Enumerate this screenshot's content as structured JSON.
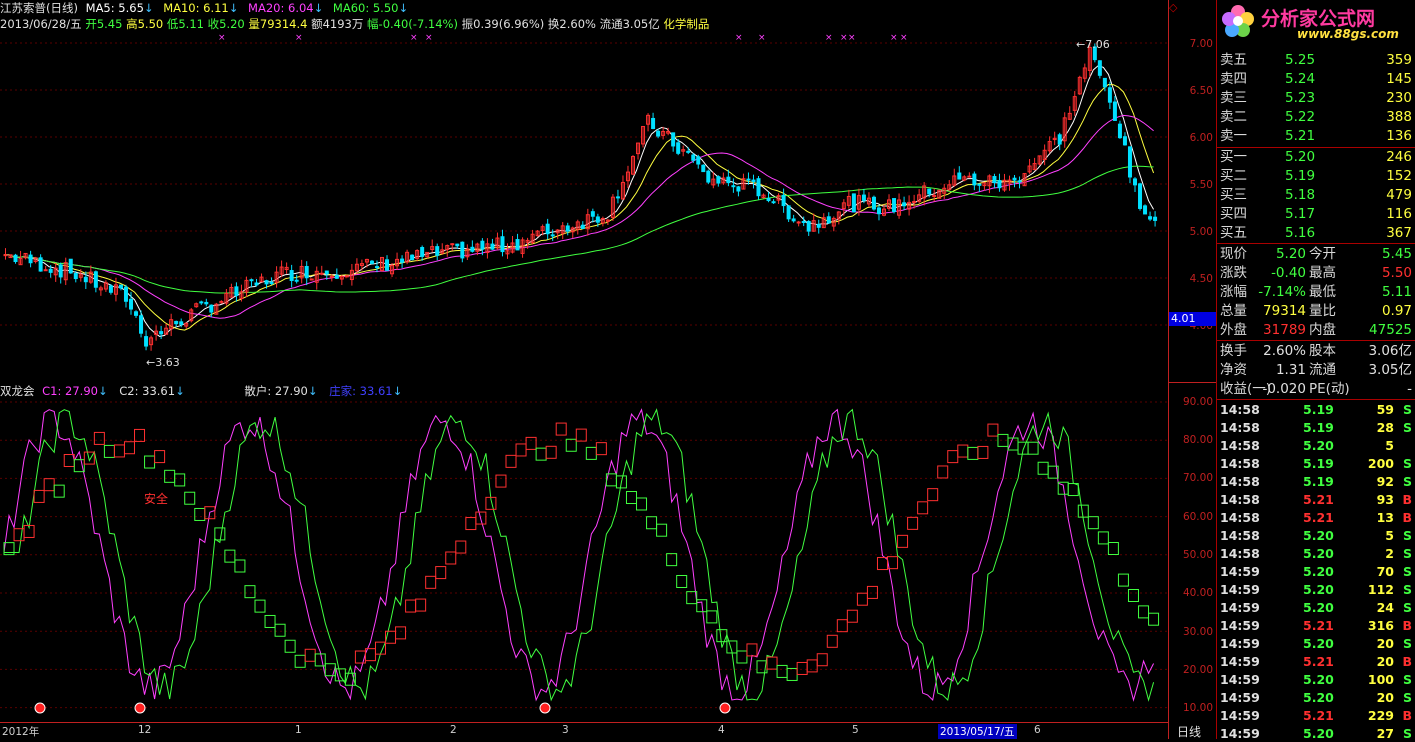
{
  "header": {
    "stock_name": "江苏索普(日线)",
    "ma5_label": "MA5: 5.65",
    "ma10_label": "MA10: 6.11",
    "ma20_label": "MA20: 6.04",
    "ma60_label": "MA60: 5.50",
    "date": "2013/06/28/五",
    "open": "开5.45",
    "high": "高5.50",
    "low": "低5.11",
    "close": "收5.20",
    "volume": "量79314.4",
    "amount": "额4193万",
    "change": "幅-0.40(-7.14%)",
    "amplitude": "振0.39(6.96%)",
    "turnover": "换2.60%",
    "float_cap": "流通3.05亿",
    "sector": "化学制品",
    "down_arrow": "↓"
  },
  "price_chart": {
    "high_label": "7.06",
    "low_label": "3.63",
    "cursor_price": "4.01",
    "axis_ticks": [
      "7.00",
      "6.50",
      "6.00",
      "5.50",
      "5.00",
      "4.50",
      "4.00"
    ],
    "colors": {
      "up": "#ff3030",
      "down": "#00e0ff",
      "ma5": "#ffffff",
      "ma10": "#ffff40",
      "ma20": "#ff40ff",
      "ma60": "#40ff40"
    }
  },
  "indicator": {
    "name": "双龙会",
    "c1": "C1: 27.90",
    "c2": "C2: 33.61",
    "sanhu": "散户: 27.90",
    "zhuangjia": "庄家: 33.61",
    "safe_label": "安全",
    "axis_ticks": [
      "90.00",
      "80.00",
      "70.00",
      "60.00",
      "50.00",
      "40.00",
      "30.00",
      "20.00",
      "10.00"
    ]
  },
  "xaxis": {
    "labels": [
      "2012年",
      "12",
      "1",
      "2",
      "3",
      "4",
      "5",
      "6"
    ],
    "cursor_date": "2013/05/17/五",
    "period_button": "日线"
  },
  "logo": {
    "title": "分析家公式网",
    "url": "www.88gs.com"
  },
  "orderbook": {
    "asks": [
      {
        "label": "卖五",
        "price": "5.25",
        "vol": "359"
      },
      {
        "label": "卖四",
        "price": "5.24",
        "vol": "145"
      },
      {
        "label": "卖三",
        "price": "5.23",
        "vol": "230"
      },
      {
        "label": "卖二",
        "price": "5.22",
        "vol": "388"
      },
      {
        "label": "卖一",
        "price": "5.21",
        "vol": "136"
      }
    ],
    "bids": [
      {
        "label": "买一",
        "price": "5.20",
        "vol": "246"
      },
      {
        "label": "买二",
        "price": "5.19",
        "vol": "152"
      },
      {
        "label": "买三",
        "price": "5.18",
        "vol": "479"
      },
      {
        "label": "买四",
        "price": "5.17",
        "vol": "116"
      },
      {
        "label": "买五",
        "price": "5.16",
        "vol": "367"
      }
    ]
  },
  "quote": {
    "rows": [
      {
        "l1": "现价",
        "v1": "5.20",
        "l2": "今开",
        "v2": "5.45"
      },
      {
        "l1": "涨跌",
        "v1": "-0.40",
        "l2": "最高",
        "v2": "5.50"
      },
      {
        "l1": "涨幅",
        "v1": "-7.14%",
        "l2": "最低",
        "v2": "5.11"
      },
      {
        "l1": "总量",
        "v1": "79314",
        "l2": "量比",
        "v2": "0.97"
      },
      {
        "l1": "外盘",
        "v1": "31789",
        "l2": "内盘",
        "v2": "47525"
      }
    ],
    "stats": [
      {
        "l1": "换手",
        "v1": "2.60%",
        "l2": "股本",
        "v2": "3.06亿"
      },
      {
        "l1": "净资",
        "v1": "1.31",
        "l2": "流通",
        "v2": "3.05亿"
      },
      {
        "l1": "收益(一)",
        "v1": "-0.020",
        "l2": "PE(动)",
        "v2": "-"
      }
    ]
  },
  "ticks": [
    {
      "time": "14:58",
      "price": "5.19",
      "vol": "59",
      "bs": "S"
    },
    {
      "time": "14:58",
      "price": "5.19",
      "vol": "28",
      "bs": "S"
    },
    {
      "time": "14:58",
      "price": "5.20",
      "vol": "5",
      "bs": ""
    },
    {
      "time": "14:58",
      "price": "5.19",
      "vol": "200",
      "bs": "S"
    },
    {
      "time": "14:58",
      "price": "5.19",
      "vol": "92",
      "bs": "S"
    },
    {
      "time": "14:58",
      "price": "5.21",
      "vol": "93",
      "bs": "B"
    },
    {
      "time": "14:58",
      "price": "5.21",
      "vol": "13",
      "bs": "B"
    },
    {
      "time": "14:58",
      "price": "5.20",
      "vol": "5",
      "bs": "S"
    },
    {
      "time": "14:58",
      "price": "5.20",
      "vol": "2",
      "bs": "S"
    },
    {
      "time": "14:59",
      "price": "5.20",
      "vol": "70",
      "bs": "S"
    },
    {
      "time": "14:59",
      "price": "5.20",
      "vol": "112",
      "bs": "S"
    },
    {
      "time": "14:59",
      "price": "5.20",
      "vol": "24",
      "bs": "S"
    },
    {
      "time": "14:59",
      "price": "5.21",
      "vol": "316",
      "bs": "B"
    },
    {
      "time": "14:59",
      "price": "5.20",
      "vol": "20",
      "bs": "S"
    },
    {
      "time": "14:59",
      "price": "5.21",
      "vol": "20",
      "bs": "B"
    },
    {
      "time": "14:59",
      "price": "5.20",
      "vol": "100",
      "bs": "S"
    },
    {
      "time": "14:59",
      "price": "5.20",
      "vol": "20",
      "bs": "S"
    },
    {
      "time": "14:59",
      "price": "5.21",
      "vol": "229",
      "bs": "B"
    },
    {
      "time": "14:59",
      "price": "5.20",
      "vol": "27",
      "bs": "S"
    }
  ]
}
